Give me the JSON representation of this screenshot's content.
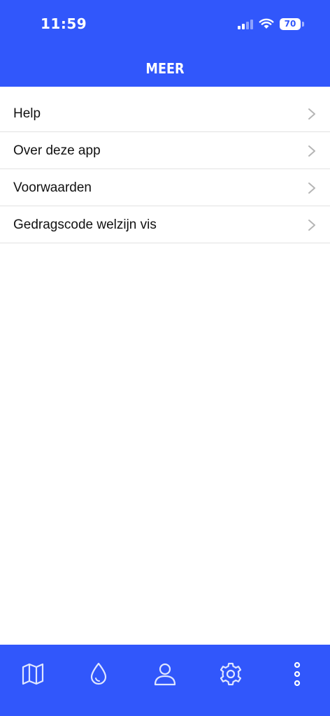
{
  "status_bar": {
    "time": "11:59",
    "battery": "70"
  },
  "header": {
    "title": "MEER",
    "background_color": "#3157fb"
  },
  "menu": {
    "items": [
      {
        "label": "Help",
        "icon": "chevron-right-icon"
      },
      {
        "label": "Over deze app",
        "icon": "chevron-right-icon"
      },
      {
        "label": "Voorwaarden",
        "icon": "chevron-right-icon"
      },
      {
        "label": "Gedragscode welzijn vis",
        "icon": "chevron-right-icon"
      }
    ]
  },
  "tab_bar": {
    "background_color": "#3157fb",
    "tabs": [
      {
        "icon": "map-icon"
      },
      {
        "icon": "water-drop-icon"
      },
      {
        "icon": "user-icon"
      },
      {
        "icon": "gear-icon"
      },
      {
        "icon": "more-vertical-icon"
      }
    ]
  }
}
